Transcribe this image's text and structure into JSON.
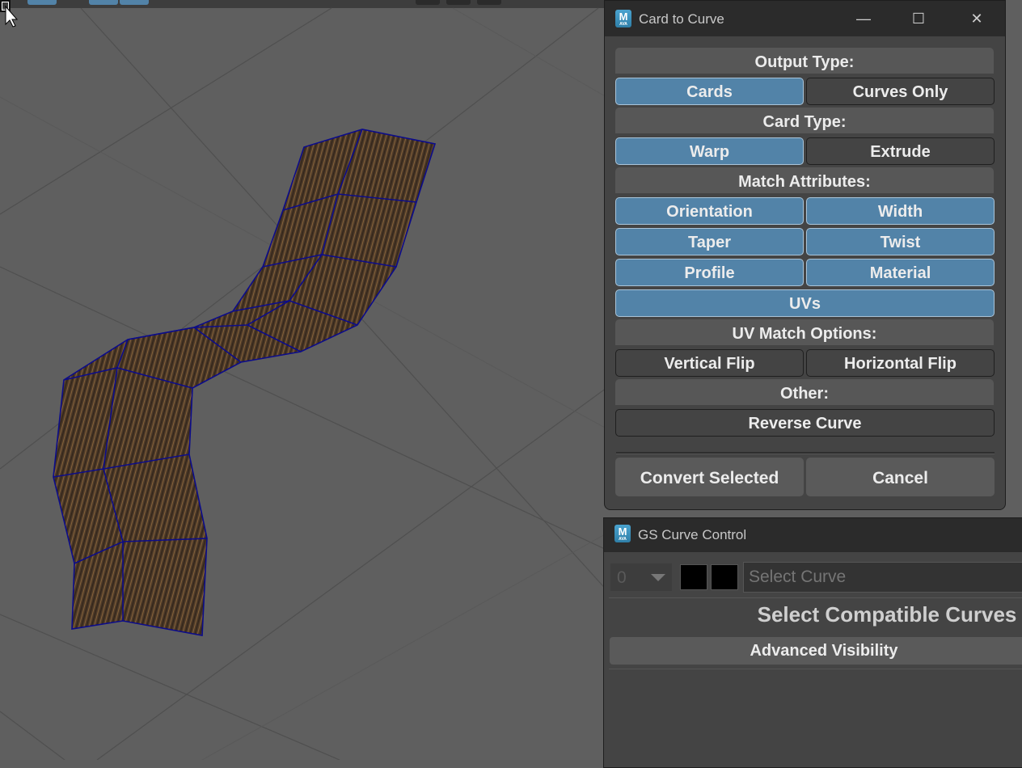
{
  "card_to_curve": {
    "title": "Card to Curve",
    "icon_letter": "M",
    "icon_sub": "AVA",
    "output_type_label": "Output Type:",
    "output_types": [
      {
        "label": "Cards",
        "active": true
      },
      {
        "label": "Curves Only",
        "active": false
      }
    ],
    "card_type_label": "Card Type:",
    "card_types": [
      {
        "label": "Warp",
        "active": true
      },
      {
        "label": "Extrude",
        "active": false
      }
    ],
    "match_attributes_label": "Match Attributes:",
    "match_attributes": [
      {
        "label": "Orientation",
        "active": true
      },
      {
        "label": "Width",
        "active": true
      },
      {
        "label": "Taper",
        "active": true
      },
      {
        "label": "Twist",
        "active": true
      },
      {
        "label": "Profile",
        "active": true
      },
      {
        "label": "Material",
        "active": true
      },
      {
        "label": "UVs",
        "active": true
      }
    ],
    "uv_match_label": "UV Match Options:",
    "uv_match_options": [
      {
        "label": "Vertical Flip",
        "active": false
      },
      {
        "label": "Horizontal Flip",
        "active": false
      }
    ],
    "other_label": "Other:",
    "reverse_curve": "Reverse Curve",
    "convert_selected": "Convert Selected",
    "cancel": "Cancel"
  },
  "gs_curve_control": {
    "title": "GS Curve Control",
    "icon_letter": "M",
    "icon_sub": "AVA",
    "layer_value": "0",
    "curve_field_placeholder": "Select Curve",
    "hint": "Select Compatible Curves",
    "advanced_visibility": "Advanced Visibility"
  },
  "colors": {
    "active_button": "#5283a8",
    "viewport_bg": "#5f5f5f",
    "wireframe": "#0c0c8a",
    "hair": "#5a3a1a"
  }
}
